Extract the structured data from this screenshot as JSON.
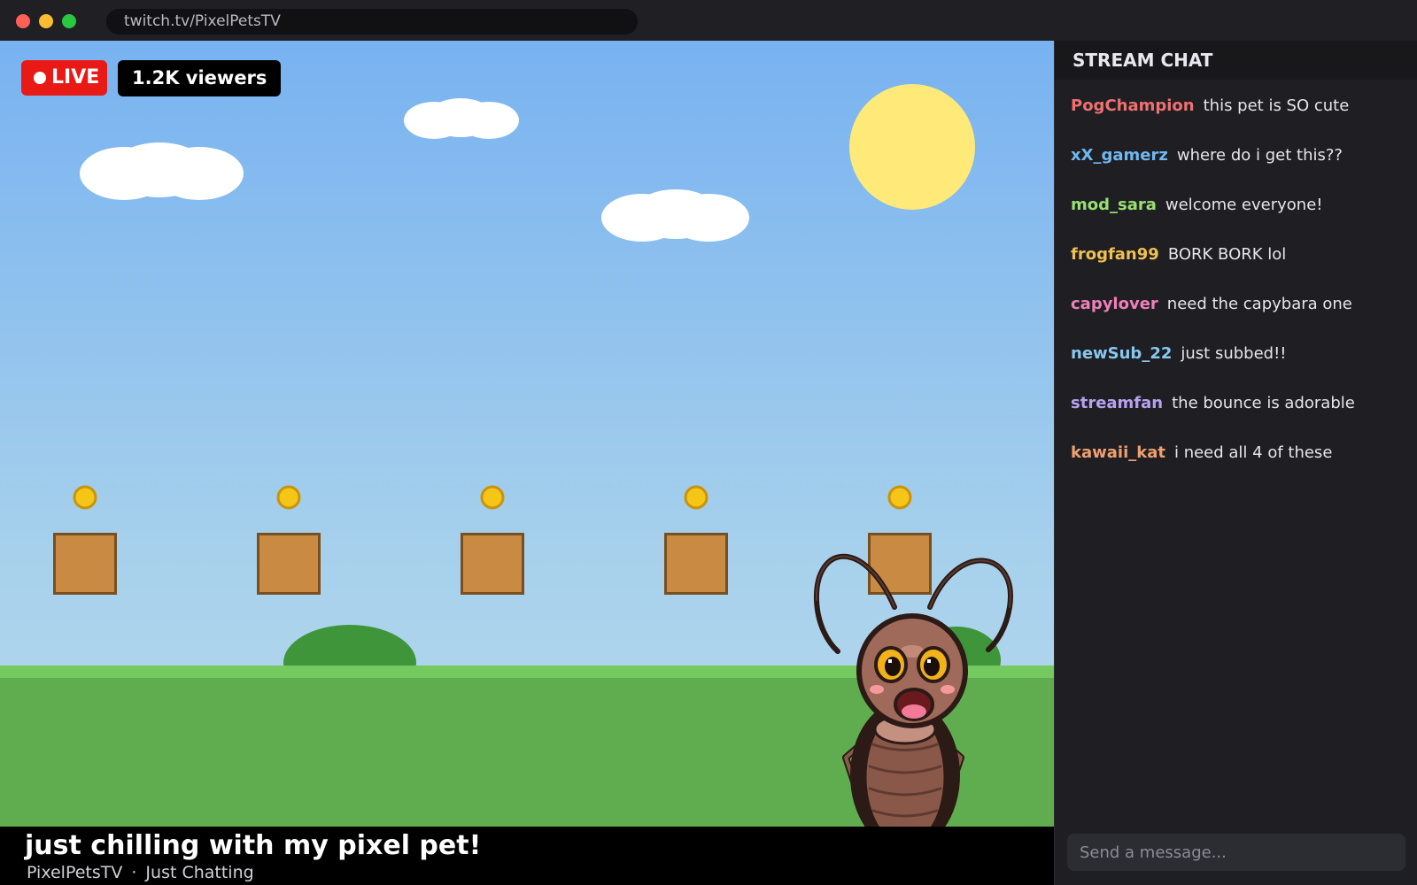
{
  "browser": {
    "url": "twitch.tv/PixelPetsTV"
  },
  "stream": {
    "live_label": "LIVE",
    "viewers": "1.2K viewers",
    "title": "just chilling with my pixel pet!",
    "channel": "PixelPetsTV",
    "separator": "·",
    "category": "Just Chatting"
  },
  "chat": {
    "header": "STREAM CHAT",
    "input_placeholder": "Send a message...",
    "messages": [
      {
        "user": "PogChampion",
        "text": "this pet is SO cute",
        "color": "#f07070"
      },
      {
        "user": "xX_gamerz",
        "text": "where do i get this??",
        "color": "#70b8f0"
      },
      {
        "user": "mod_sara",
        "text": "welcome everyone!",
        "color": "#98e070"
      },
      {
        "user": "frogfan99",
        "text": "BORK BORK lol",
        "color": "#f0c050"
      },
      {
        "user": "capylover",
        "text": "need the capybara one",
        "color": "#f080b8"
      },
      {
        "user": "newSub_22",
        "text": "just subbed!!",
        "color": "#88c8f0"
      },
      {
        "user": "streamfan",
        "text": "the bounce is adorable",
        "color": "#b8a0f0"
      },
      {
        "user": "kawaii_kat",
        "text": "i need all 4 of these",
        "color": "#f0a070"
      }
    ]
  },
  "colors": {
    "live_red": "#e91916",
    "sky": "#78b2f1",
    "grass": "#5fad4f",
    "sun": "#ffe978",
    "block": "#c98b44",
    "coin": "#f5c518"
  }
}
